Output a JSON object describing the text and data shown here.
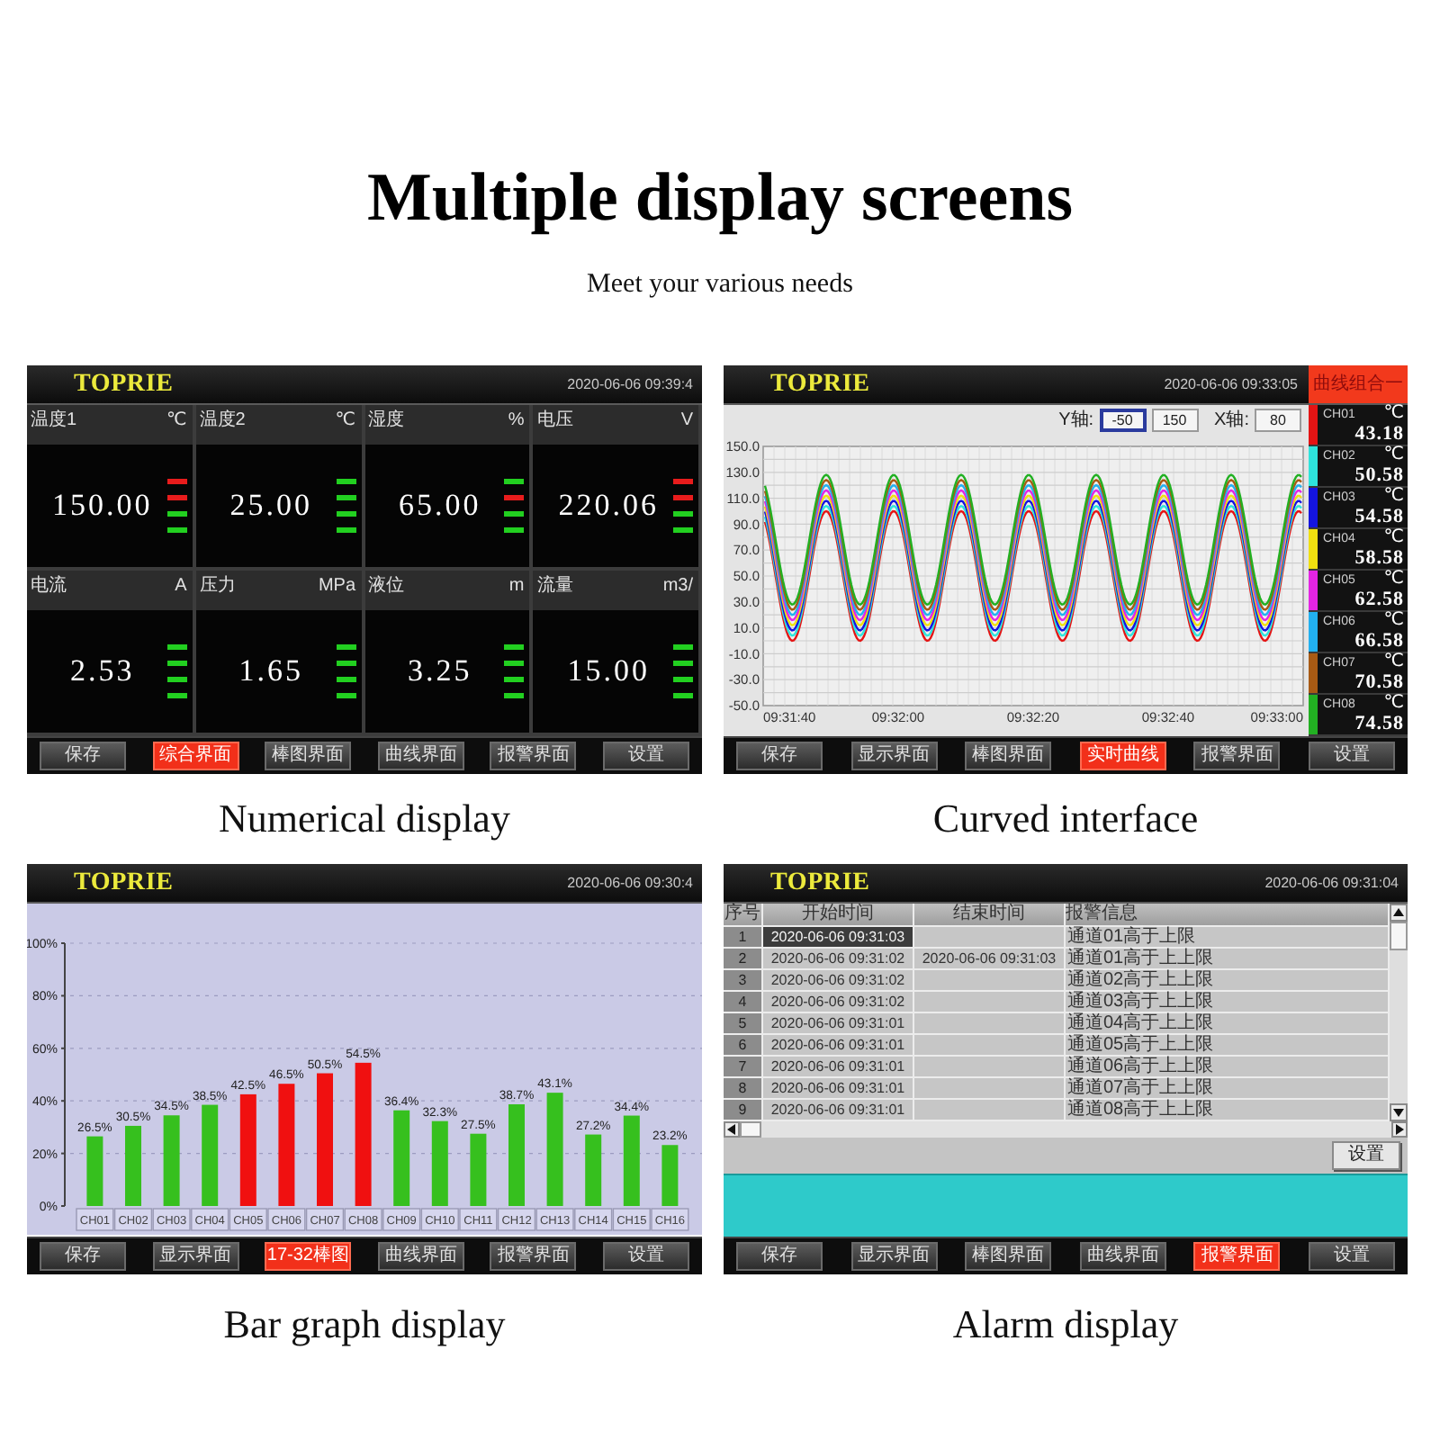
{
  "heading": {
    "title": "Multiple display screens",
    "subtitle": "Meet your various needs"
  },
  "screens": [
    {
      "kind": "numeric",
      "caption": "Numerical display",
      "brand": "TOPRIE",
      "timestamp": "2020-06-06 09:39:4",
      "tiles": [
        {
          "label": "温度1",
          "unit": "℃",
          "value": "150.00",
          "indicators": [
            {
              "alarm": true
            },
            {
              "alarm": true
            },
            {
              "alarm": false
            },
            {
              "alarm": false
            }
          ]
        },
        {
          "label": "温度2",
          "unit": "℃",
          "value": "25.00",
          "indicators": [
            {
              "alarm": false
            },
            {
              "alarm": false
            },
            {
              "alarm": false
            },
            {
              "alarm": false
            }
          ]
        },
        {
          "label": "湿度",
          "unit": "%",
          "value": "65.00",
          "indicators": [
            {
              "alarm": false
            },
            {
              "alarm": true
            },
            {
              "alarm": false
            },
            {
              "alarm": false
            }
          ]
        },
        {
          "label": "电压",
          "unit": "V",
          "value": "220.06",
          "indicators": [
            {
              "alarm": true
            },
            {
              "alarm": true
            },
            {
              "alarm": false
            },
            {
              "alarm": false
            }
          ]
        },
        {
          "label": "电流",
          "unit": "A",
          "value": "2.53",
          "indicators": [
            {
              "alarm": false
            },
            {
              "alarm": false
            },
            {
              "alarm": false
            },
            {
              "alarm": false
            }
          ]
        },
        {
          "label": "压力",
          "unit": "MPa",
          "value": "1.65",
          "indicators": [
            {
              "alarm": false
            },
            {
              "alarm": false
            },
            {
              "alarm": false
            },
            {
              "alarm": false
            }
          ]
        },
        {
          "label": "液位",
          "unit": "m",
          "value": "3.25",
          "indicators": [
            {
              "alarm": false
            },
            {
              "alarm": false
            },
            {
              "alarm": false
            },
            {
              "alarm": false
            }
          ]
        },
        {
          "label": "流量",
          "unit": "m3/",
          "value": "15.00",
          "indicators": [
            {
              "alarm": false
            },
            {
              "alarm": false
            },
            {
              "alarm": false
            },
            {
              "alarm": false
            }
          ]
        }
      ],
      "buttons": [
        {
          "label": "保存",
          "selected": false
        },
        {
          "label": "综合界面",
          "selected": true
        },
        {
          "label": "棒图界面",
          "selected": false
        },
        {
          "label": "曲线界面",
          "selected": false
        },
        {
          "label": "报警界面",
          "selected": false
        },
        {
          "label": "设置",
          "selected": false
        }
      ]
    },
    {
      "kind": "curve",
      "caption": "Curved interface",
      "brand": "TOPRIE",
      "timestamp": "2020-06-06 09:33:05",
      "group_button": "曲线组合一",
      "axis_fields": [
        {
          "label": "Y轴:",
          "fields": [
            {
              "value": "-50",
              "focused": true
            },
            {
              "value": "150",
              "focused": false
            }
          ]
        },
        {
          "label": "X轴:",
          "fields": [
            {
              "value": "80",
              "focused": false
            }
          ]
        }
      ],
      "y_axis_labels": [
        "150.0",
        "130.0",
        "110.0",
        "90.0",
        "70.0",
        "50.0",
        "30.0",
        "10.0",
        "-10.0",
        "-30.0",
        "-50.0"
      ],
      "x_axis_labels": [
        "09:31:40",
        "09:32:00",
        "09:32:20",
        "09:32:40",
        "09:33:00"
      ],
      "channels": [
        {
          "name": "CH01",
          "unit": "℃",
          "value": "43.18",
          "color": "#e41414"
        },
        {
          "name": "CH02",
          "unit": "℃",
          "value": "50.58",
          "color": "#2ee4dc"
        },
        {
          "name": "CH03",
          "unit": "℃",
          "value": "54.58",
          "color": "#1414e0"
        },
        {
          "name": "CH04",
          "unit": "℃",
          "value": "58.58",
          "color": "#f0e010"
        },
        {
          "name": "CH05",
          "unit": "℃",
          "value": "62.58",
          "color": "#e424e4"
        },
        {
          "name": "CH06",
          "unit": "℃",
          "value": "66.58",
          "color": "#22b0f0"
        },
        {
          "name": "CH07",
          "unit": "℃",
          "value": "70.58",
          "color": "#a85a14"
        },
        {
          "name": "CH08",
          "unit": "℃",
          "value": "74.58",
          "color": "#22b022"
        }
      ],
      "buttons": [
        {
          "label": "保存",
          "selected": false
        },
        {
          "label": "显示界面",
          "selected": false
        },
        {
          "label": "棒图界面",
          "selected": false
        },
        {
          "label": "实时曲线",
          "selected": true
        },
        {
          "label": "报警界面",
          "selected": false
        },
        {
          "label": "设置",
          "selected": false
        }
      ]
    },
    {
      "kind": "bar",
      "caption": "Bar graph display",
      "brand": "TOPRIE",
      "timestamp": "2020-06-06 09:30:4",
      "chart_data": {
        "type": "bar",
        "categories": [
          "CH01",
          "CH02",
          "CH03",
          "CH04",
          "CH05",
          "CH06",
          "CH07",
          "CH08",
          "CH09",
          "CH10",
          "CH11",
          "CH12",
          "CH13",
          "CH14",
          "CH15",
          "CH16"
        ],
        "series": [
          {
            "color": "#36c01e",
            "values": [
              26.5,
              30.5,
              34.5,
              38.5,
              null,
              null,
              null,
              null,
              36.4,
              32.3,
              27.5,
              38.7,
              43.1,
              27.2,
              34.4,
              23.2
            ]
          },
          {
            "color": "#f01010",
            "values": [
              null,
              null,
              null,
              null,
              42.5,
              46.5,
              50.5,
              54.5,
              null,
              null,
              null,
              null,
              null,
              null,
              null,
              null
            ]
          }
        ],
        "stacked": true,
        "grid": true,
        "ylim": [
          0,
          100
        ],
        "yticks": [
          {
            "value": 0,
            "label": "0%"
          },
          {
            "value": 20,
            "label": "20%"
          },
          {
            "value": 40,
            "label": "40%"
          },
          {
            "value": 60,
            "label": "60%"
          },
          {
            "value": 80,
            "label": "80%"
          },
          {
            "value": 100,
            "label": "100%"
          }
        ],
        "value_labels": [
          "26.5%",
          "30.5%",
          "34.5%",
          "38.5%",
          "42.5%",
          "46.5%",
          "50.5%",
          "54.5%",
          "36.4%",
          "32.3%",
          "27.5%",
          "38.7%",
          "43.1%",
          "27.2%",
          "34.4%",
          "23.2%"
        ]
      },
      "buttons": [
        {
          "label": "保存",
          "selected": false
        },
        {
          "label": "显示界面",
          "selected": false
        },
        {
          "label": "17-32棒图",
          "selected": true
        },
        {
          "label": "曲线界面",
          "selected": false
        },
        {
          "label": "报警界面",
          "selected": false
        },
        {
          "label": "设置",
          "selected": false
        }
      ]
    },
    {
      "kind": "alarm",
      "caption": "Alarm display",
      "brand": "TOPRIE",
      "timestamp": "2020-06-06 09:31:04",
      "table": {
        "columns": [
          "序号",
          "开始时间",
          "结束时间",
          "报警信息"
        ],
        "rows": [
          {
            "number": "1",
            "start": "2020-06-06 09:31:03",
            "message": "通道01高于上限",
            "selected": true
          },
          {
            "number": "2",
            "start": "2020-06-06 09:31:02",
            "end": "2020-06-06 09:31:03",
            "message": "通道01高于上上限",
            "selected": false
          },
          {
            "number": "3",
            "start": "2020-06-06 09:31:02",
            "message": "通道02高于上上限",
            "selected": false
          },
          {
            "number": "4",
            "start": "2020-06-06 09:31:02",
            "message": "通道03高于上上限",
            "selected": false
          },
          {
            "number": "5",
            "start": "2020-06-06 09:31:01",
            "message": "通道04高于上上限",
            "selected": false
          },
          {
            "number": "6",
            "start": "2020-06-06 09:31:01",
            "message": "通道05高于上上限",
            "selected": false
          },
          {
            "number": "7",
            "start": "2020-06-06 09:31:01",
            "message": "通道06高于上上限",
            "selected": false
          },
          {
            "number": "8",
            "start": "2020-06-06 09:31:01",
            "message": "通道07高于上上限",
            "selected": false
          },
          {
            "number": "9",
            "start": "2020-06-06 09:31:01",
            "message": "通道08高于上上限",
            "selected": false
          }
        ]
      },
      "settings_button": "设置",
      "buttons": [
        {
          "label": "保存",
          "selected": false
        },
        {
          "label": "显示界面",
          "selected": false
        },
        {
          "label": "棒图界面",
          "selected": false
        },
        {
          "label": "曲线界面",
          "selected": false
        },
        {
          "label": "报警界面",
          "selected": true
        },
        {
          "label": "设置",
          "selected": false
        }
      ]
    }
  ]
}
